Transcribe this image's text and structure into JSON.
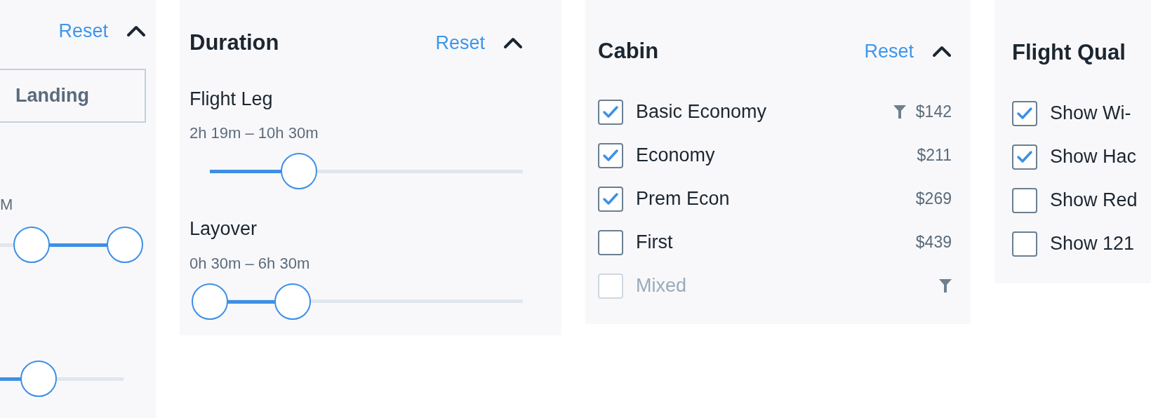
{
  "panels": [
    {
      "kind": "time",
      "reset": "Reset",
      "expanded": true,
      "tabs": [
        {
          "label": "Landing",
          "selected": true
        }
      ],
      "sliders": [
        {
          "reading": "M",
          "thumbs": [
            {
              "level": 0.25
            },
            {
              "level": 1
            }
          ]
        },
        {
          "thumbs": [
            {
              "level": 0.31
            }
          ]
        }
      ]
    },
    {
      "kind": "duration",
      "title": "Duration",
      "reset": "Reset",
      "expanded": true,
      "sliders": [
        {
          "label": "Flight Leg",
          "reading": "2h 19m – 10h 30m",
          "thumbs": [
            {
              "level": 0.285
            }
          ]
        },
        {
          "label": "Layover",
          "reading": "0h 30m – 6h 30m",
          "thumbs": [
            {
              "level": 0
            },
            {
              "level": 0.265
            }
          ]
        }
      ]
    },
    {
      "kind": "checklist",
      "title": "Cabin",
      "reset": "Reset",
      "expanded": true,
      "options": [
        {
          "label": "Basic Economy",
          "checked": true,
          "disabled": false,
          "filtered": true,
          "price": "$142"
        },
        {
          "label": "Economy",
          "checked": true,
          "disabled": false,
          "filtered": false,
          "price": "$211"
        },
        {
          "label": "Prem Econ",
          "checked": true,
          "disabled": false,
          "filtered": false,
          "price": "$269"
        },
        {
          "label": "First",
          "checked": false,
          "disabled": false,
          "filtered": false,
          "price": "$439"
        },
        {
          "label": "Mixed",
          "checked": false,
          "disabled": true,
          "filtered": true
        }
      ]
    },
    {
      "kind": "checklist",
      "title": "Flight Qual",
      "options": [
        {
          "label": "Show Wi-",
          "checked": true,
          "disabled": false
        },
        {
          "label": "Show Hac",
          "checked": true,
          "disabled": false
        },
        {
          "label": "Show Red",
          "checked": false,
          "disabled": false
        },
        {
          "label": "Show 121",
          "checked": false,
          "disabled": false
        }
      ]
    }
  ]
}
